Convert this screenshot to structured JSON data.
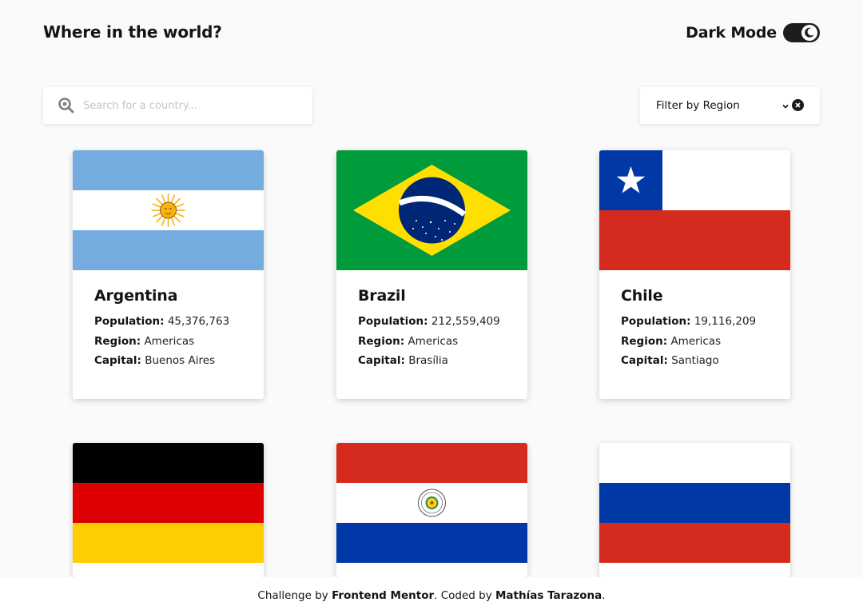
{
  "header": {
    "title": "Where in the world?",
    "theme_toggle_label": "Dark Mode"
  },
  "search": {
    "placeholder": "Search for a country...",
    "value": ""
  },
  "filter": {
    "label": "Filter by Region"
  },
  "colors": {
    "background": "#fafafa",
    "card": "#ffffff",
    "text": "#111517",
    "toggle": "#1d1d1d"
  },
  "labels": {
    "population": "Population:",
    "region": "Region:",
    "capital": "Capital:"
  },
  "countries": [
    {
      "name": "Argentina",
      "population": "45,376,763",
      "region": "Americas",
      "capital": "Buenos Aires",
      "flag_icon": "argentina-flag"
    },
    {
      "name": "Brazil",
      "population": "212,559,409",
      "region": "Americas",
      "capital": "Brasília",
      "flag_icon": "brazil-flag"
    },
    {
      "name": "Chile",
      "population": "19,116,209",
      "region": "Americas",
      "capital": "Santiago",
      "flag_icon": "chile-flag"
    },
    {
      "name": "",
      "flag_icon": "germany-flag"
    },
    {
      "name": "",
      "flag_icon": "paraguay-flag"
    },
    {
      "name": "",
      "flag_icon": "russia-flag"
    }
  ],
  "footer": {
    "prefix": "Challenge by",
    "challenge_link": "Frontend Mentor",
    "middle": ". Coded by",
    "author_link": "Mathías Tarazona",
    "suffix": "."
  }
}
